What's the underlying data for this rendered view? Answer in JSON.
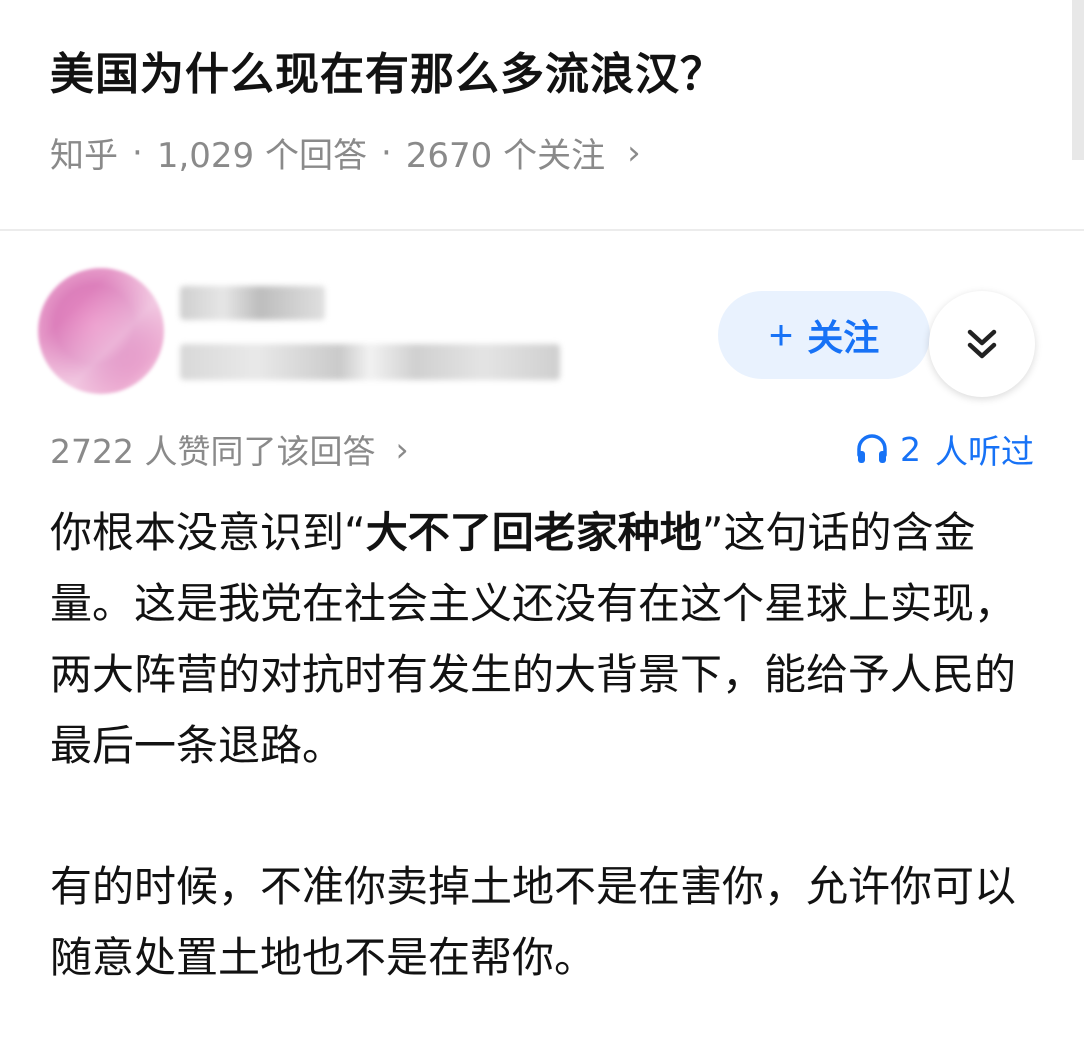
{
  "question": {
    "title": "美国为什么现在有那么多流浪汉？",
    "source": "知乎",
    "answers": "1,029 个回答",
    "followers": "2670 个关注",
    "chevron": "›"
  },
  "author": {
    "follow_label": "关注",
    "follow_plus": "+",
    "expand_icon": "double-chevron-down-icon"
  },
  "stats": {
    "upvotes": "2722 人赞同了该回答",
    "upvotes_chevron": "›",
    "listen_count": "2",
    "listen_suffix": "人听过"
  },
  "answer": {
    "p1_before": "你根本没意识到“",
    "p1_bold": "大不了回老家种地",
    "p1_after": "”这句话的含金量。这是我党在社会主义还没有在这个星球上实现，两大阵营的对抗时有发生的大背景下，能给予人民的最后一条退路。",
    "p2": "有的时候，不准你卖掉土地不是在害你，允许你可以随意处置土地也不是在帮你。"
  },
  "colors": {
    "accent": "#1772f6",
    "follow_bg": "#e9f2fe",
    "meta_text": "#8a8a8a"
  }
}
